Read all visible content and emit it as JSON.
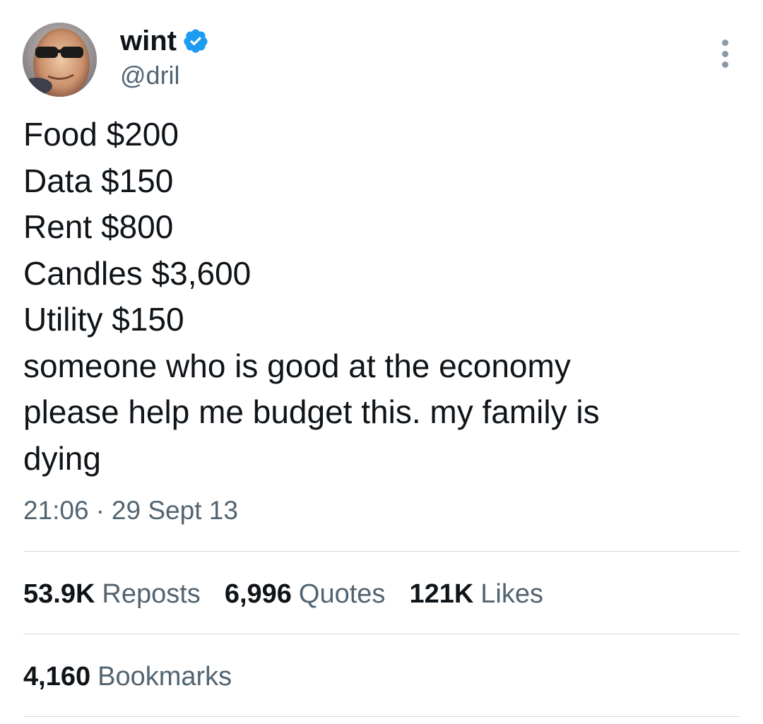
{
  "author": {
    "display_name": "wint",
    "handle": "@dril",
    "verified": true,
    "verified_color": "#1d9bf0",
    "avatar_icon": "avatar-photo"
  },
  "tweet": {
    "lines": [
      "Food $200",
      "Data $150",
      "Rent $800",
      "Candles $3,600",
      "Utility $150",
      "someone who is good at the economy",
      "please help me budget this. my family is",
      "dying"
    ],
    "time": "21:06",
    "separator": "·",
    "date": "29 Sept 13"
  },
  "stats": {
    "reposts": {
      "count": "53.9K",
      "label": "Reposts"
    },
    "quotes": {
      "count": "6,996",
      "label": "Quotes"
    },
    "likes": {
      "count": "121K",
      "label": "Likes"
    },
    "bookmarks": {
      "count": "4,160",
      "label": "Bookmarks"
    }
  },
  "menu_icon": "more-vertical-icon"
}
